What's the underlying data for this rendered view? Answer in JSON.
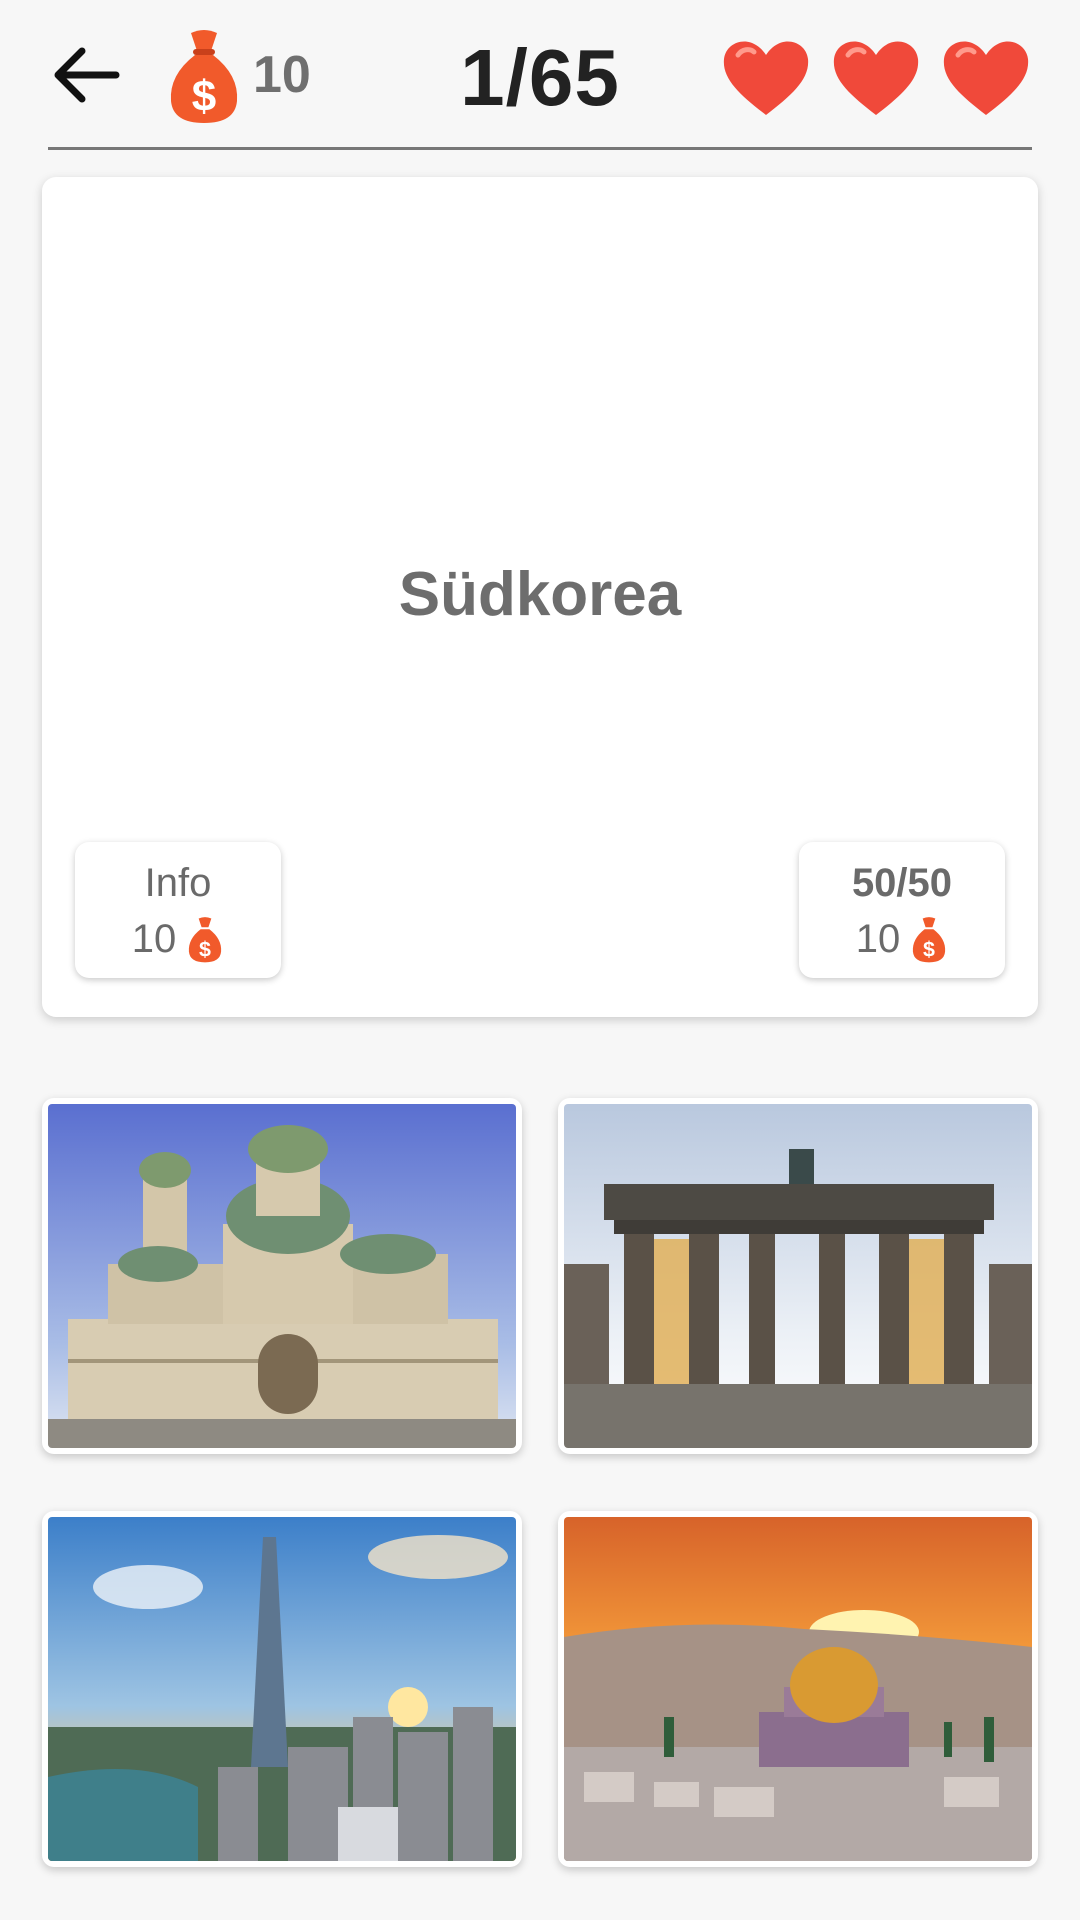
{
  "header": {
    "coins": "10",
    "progress": "1/65",
    "lives": 3
  },
  "question": {
    "country": "Südkorea"
  },
  "hints": {
    "info": {
      "label": "Info",
      "cost": "10"
    },
    "fifty": {
      "label": "50/50",
      "cost": "10"
    }
  },
  "options": [
    {
      "name": "Alexander Nevsky Cathedral"
    },
    {
      "name": "Brandenburg Gate"
    },
    {
      "name": "Lotte World Tower"
    },
    {
      "name": "Dome of the Rock"
    }
  ],
  "colors": {
    "accent": "#f0502a",
    "heart": "#f0493a",
    "text": "#6d6d6d"
  }
}
